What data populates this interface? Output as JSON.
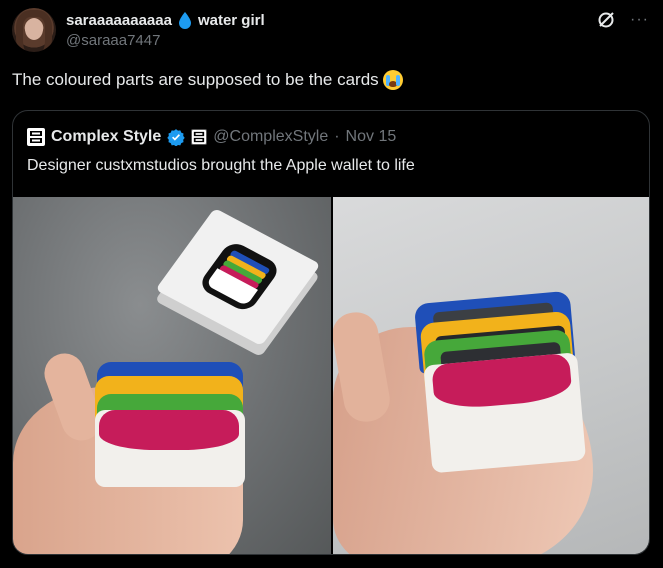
{
  "tweet": {
    "display_name": "saraaaaaaaaaa",
    "name_suffix": "water girl",
    "handle": "@saraaa7447",
    "text": "The coloured parts are supposed to be the cards",
    "emoji": "loudly-crying-face-emoji",
    "more_label": "···"
  },
  "quote": {
    "display_name": "Complex Style",
    "handle": "@ComplexStyle",
    "separator": "·",
    "date": "Nov 15",
    "text": "Designer custxmstudios brought the Apple wallet to life",
    "logo_text": "CPLX STYLE"
  },
  "colors": {
    "background": "#000000",
    "text": "#e7e9ea",
    "muted": "#71767b",
    "border": "#2f3336",
    "verified": "#1d9bf0",
    "wallet_blue": "#1f4fb8",
    "wallet_yellow": "#f2b21b",
    "wallet_green": "#46a83a",
    "wallet_pink": "#c61c5a",
    "wallet_white": "#f2f0ec"
  },
  "icons": [
    "water-drop-icon",
    "grok-icon",
    "more-icon",
    "verified-badge-icon"
  ]
}
